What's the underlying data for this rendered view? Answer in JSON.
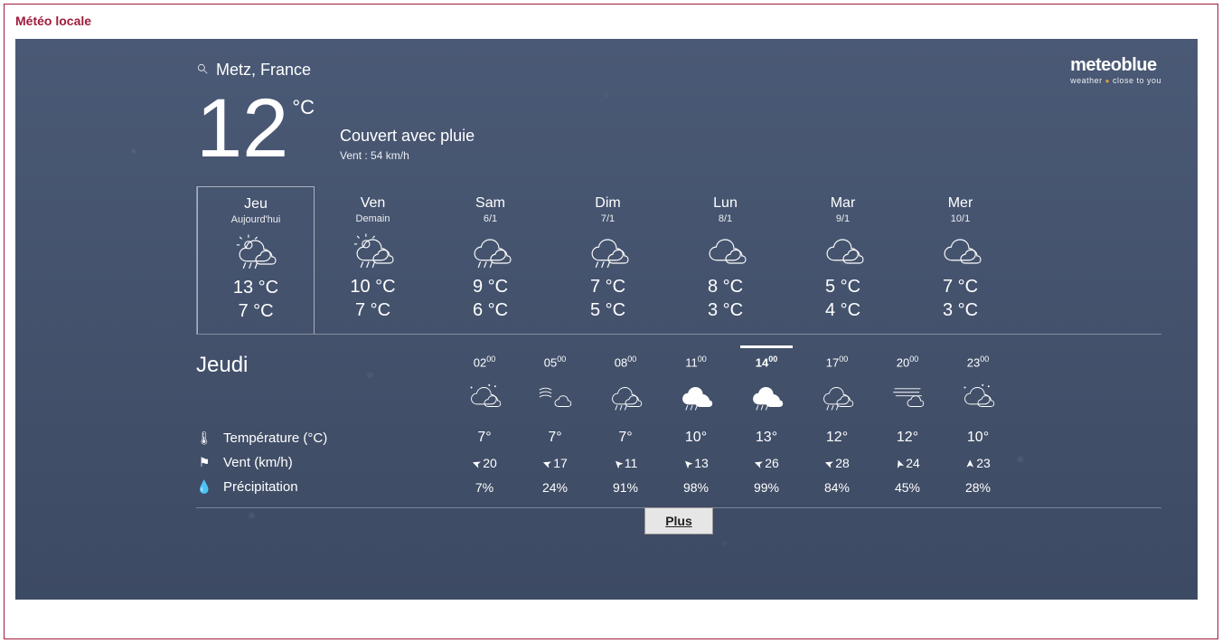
{
  "widget_title": "Météo locale",
  "brand": {
    "logo": "meteoblue",
    "tagline_left": "weather",
    "tagline_right": "close to you"
  },
  "location": "Metz, France",
  "current": {
    "temp": "12",
    "unit": "°C",
    "description": "Couvert avec pluie",
    "wind_label": "Vent : 54 km/h"
  },
  "days": [
    {
      "name": "Jeu",
      "sub": "Aujourd'hui",
      "hi": "13 °C",
      "lo": "7 °C",
      "icon": "sun-rain-cloud",
      "active": true
    },
    {
      "name": "Ven",
      "sub": "Demain",
      "hi": "10 °C",
      "lo": "7 °C",
      "icon": "sun-rain-cloud"
    },
    {
      "name": "Sam",
      "sub": "6/1",
      "hi": "9 °C",
      "lo": "6 °C",
      "icon": "rain-cloud"
    },
    {
      "name": "Dim",
      "sub": "7/1",
      "hi": "7 °C",
      "lo": "5 °C",
      "icon": "rain-cloud"
    },
    {
      "name": "Lun",
      "sub": "8/1",
      "hi": "8 °C",
      "lo": "3 °C",
      "icon": "clouds"
    },
    {
      "name": "Mar",
      "sub": "9/1",
      "hi": "5 °C",
      "lo": "4 °C",
      "icon": "clouds"
    },
    {
      "name": "Mer",
      "sub": "10/1",
      "hi": "7 °C",
      "lo": "3 °C",
      "icon": "clouds"
    }
  ],
  "hourly": {
    "day_label": "Jeudi",
    "hours": [
      "02",
      "05",
      "08",
      "11",
      "14",
      "17",
      "20",
      "23"
    ],
    "minutes": [
      "00",
      "00",
      "00",
      "00",
      "00",
      "00",
      "00",
      "00"
    ],
    "current_index": 4,
    "icons": [
      "night-cloud",
      "wind-cloud",
      "rain-cloud",
      "heavy-rain-filled",
      "heavy-rain-filled",
      "rain-cloud",
      "fog-cloud",
      "night-cloud"
    ],
    "rows": {
      "temp": {
        "label": "Température (°C)",
        "icon": "thermometer-icon",
        "values": [
          "7°",
          "7°",
          "7°",
          "10°",
          "13°",
          "12°",
          "12°",
          "10°"
        ]
      },
      "wind": {
        "label": "Vent (km/h)",
        "icon": "flag-icon",
        "values": [
          "20",
          "17",
          "11",
          "13",
          "26",
          "28",
          "24",
          "23"
        ],
        "dirs": [
          200,
          200,
          225,
          225,
          200,
          200,
          250,
          270
        ]
      },
      "precip": {
        "label": "Précipitation",
        "icon": "droplet-icon",
        "values": [
          "7%",
          "24%",
          "91%",
          "98%",
          "99%",
          "84%",
          "45%",
          "28%"
        ]
      }
    }
  },
  "more_button": "Plus"
}
